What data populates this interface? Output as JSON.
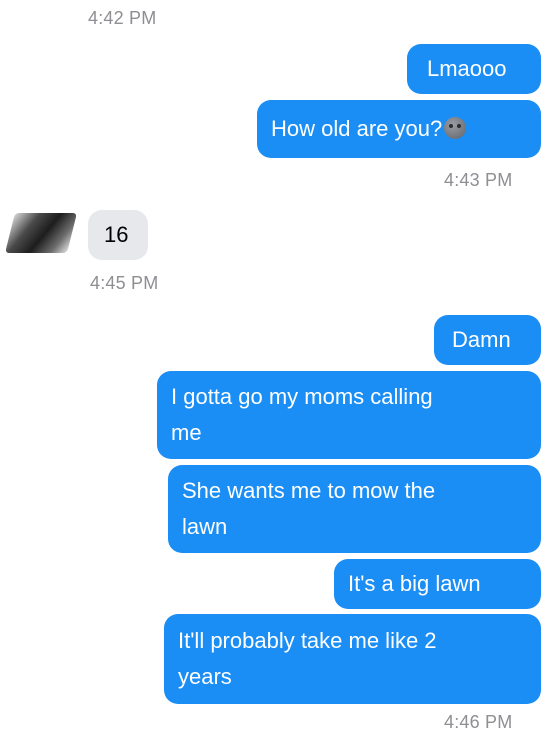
{
  "messages": {
    "ts1": "4:42 PM",
    "out1": "Lmaooo",
    "out2": "How old are you?",
    "out2_emoji": "frowning-moon-face-emoji",
    "ts2": "4:43 PM",
    "in1": "16",
    "ts3": "4:45 PM",
    "out3": "Damn",
    "out4_line1": "I gotta go my moms calling",
    "out4_line2": "me",
    "out5_line1": "She wants me to mow the",
    "out5_line2": "lawn",
    "out6": "It's a big lawn",
    "out7_line1": "It'll probably take me like 2",
    "out7_line2": "years",
    "ts4": "4:46 PM"
  },
  "colors": {
    "outgoing_bubble": "#1b8ef5",
    "incoming_bubble": "#e6e8ec",
    "timestamp": "#8e8e93"
  }
}
